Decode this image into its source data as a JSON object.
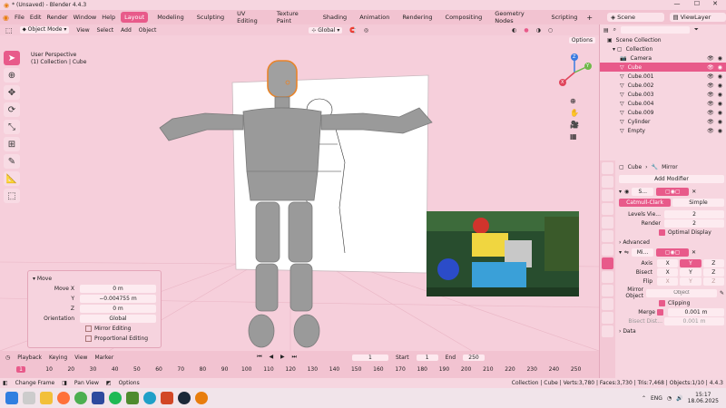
{
  "window": {
    "title": "* (Unsaved) - Blender 4.4.3",
    "controls": [
      "—",
      "☐",
      "✕"
    ]
  },
  "menu": {
    "items": [
      "File",
      "Edit",
      "Render",
      "Window",
      "Help"
    ],
    "workspaces": [
      "Layout",
      "Modeling",
      "Sculpting",
      "UV Editing",
      "Texture Paint",
      "Shading",
      "Animation",
      "Rendering",
      "Compositing",
      "Geometry Nodes",
      "Scripting"
    ],
    "active_workspace": "Layout",
    "scene": "Scene",
    "view_layer": "ViewLayer"
  },
  "viewport_header": {
    "mode": "Object Mode",
    "items": [
      "View",
      "Select",
      "Add",
      "Object"
    ],
    "transform": "Global",
    "options": "Options"
  },
  "viewport": {
    "perspective": "User Perspective",
    "collection": "(1) Collection | Cube",
    "gizmo": {
      "z": "Z",
      "y": "Y",
      "x": "X"
    }
  },
  "tools": [
    "cursor",
    "move",
    "rotate",
    "scale",
    "transform",
    "annotate",
    "measure",
    "add-cube"
  ],
  "operator_panel": {
    "title": "Move",
    "move_x_label": "Move X",
    "move_x": "0 m",
    "y_label": "Y",
    "y": "−0.004755 m",
    "z_label": "Z",
    "z": "0 m",
    "orientation_label": "Orientation",
    "orientation": "Global",
    "mirror_editing": "Mirror Editing",
    "proportional_editing": "Proportional Editing"
  },
  "timeline": {
    "menu": [
      "Playback",
      "Keying",
      "View",
      "Marker"
    ],
    "current_frame": "1",
    "start_label": "Start",
    "start": "1",
    "end_label": "End",
    "end": "250",
    "ticks": [
      "1",
      "10",
      "20",
      "30",
      "40",
      "50",
      "60",
      "70",
      "80",
      "90",
      "100",
      "110",
      "120",
      "130",
      "140",
      "150",
      "160",
      "170",
      "180",
      "190",
      "200",
      "210",
      "220",
      "230",
      "240",
      "250"
    ]
  },
  "status": {
    "left": [
      "Change Frame",
      "Pan View",
      "Options"
    ],
    "right": "Collection | Cube | Verts:3,780 | Faces:3,730 | Tris:7,468 | Objects:1/10 | 4.4.3"
  },
  "taskbar": {
    "time": "15:17",
    "date": "18.06.2025",
    "lang": "ENG",
    "apps": [
      "windows",
      "search",
      "files",
      "firefox",
      "chrome",
      "steam-like",
      "spotify",
      "minecraft",
      "edge",
      "powerpoint",
      "steam",
      "blender"
    ]
  },
  "outliner": {
    "search_placeholder": "",
    "root": "Scene Collection",
    "collection": "Collection",
    "items": [
      "Camera",
      "Cube",
      "Cube.001",
      "Cube.002",
      "Cube.003",
      "Cube.004",
      "Cube.009",
      "Cylinder",
      "Empty"
    ],
    "selected": "Cube"
  },
  "properties": {
    "object": "Cube",
    "modifier": "Mirror",
    "add_modifier": "Add Modifier",
    "subsurf": {
      "name": "S...",
      "catmull": "Catmull-Clark",
      "simple": "Simple",
      "levels_label": "Levels Vie...",
      "levels": "2",
      "render_label": "Render",
      "render": "2",
      "optimal": "Optimal Display",
      "advanced": "Advanced"
    },
    "mirror": {
      "name": "Mi...",
      "axis_label": "Axis",
      "bisect_label": "Bisect",
      "flip_label": "Flip",
      "x": "X",
      "y": "Y",
      "z": "Z",
      "mirror_object_label": "Mirror Object",
      "mirror_object_placeholder": "Object",
      "clipping": "Clipping",
      "merge_label": "Merge",
      "merge": "0.001 m",
      "bisect_dist_label": "Bisect Dist...",
      "bisect_dist": "0.001 m",
      "data": "Data"
    }
  },
  "colors": {
    "accent": "#e85a8a",
    "panel": "#f7d6e0",
    "viewport": "#f6cfdb"
  }
}
